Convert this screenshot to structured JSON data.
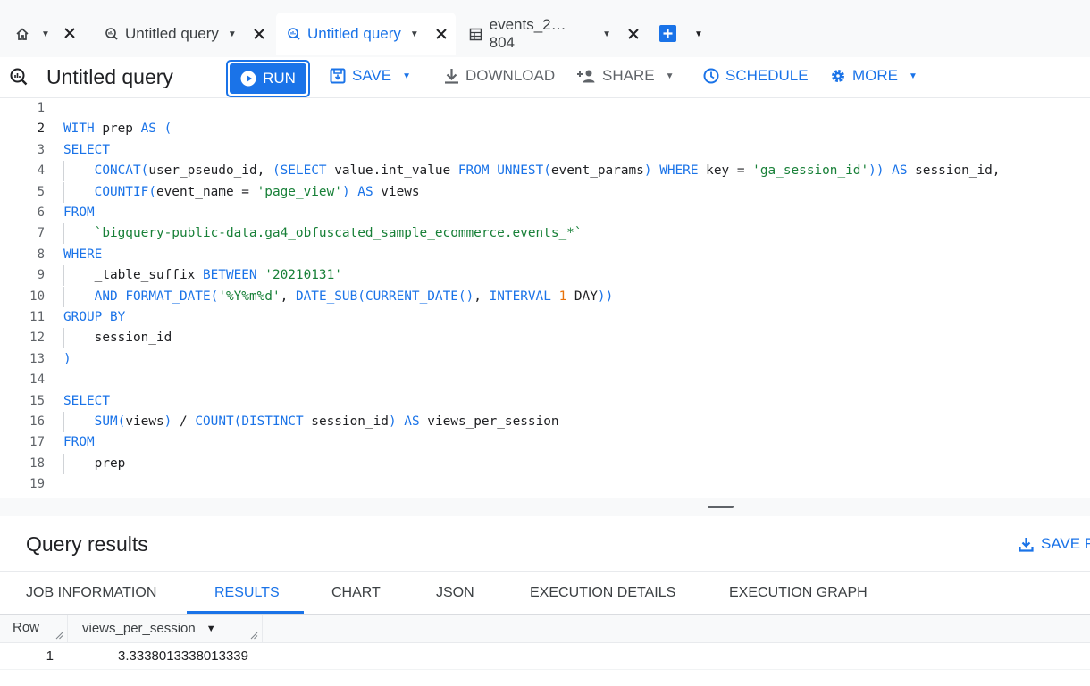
{
  "tabs": [
    {
      "label": "Untitled query",
      "active": false
    },
    {
      "label": "Untitled query",
      "active": true
    },
    {
      "label": "events_2… 804",
      "active": false
    }
  ],
  "toolbar": {
    "title": "Untitled query",
    "run_label": "RUN",
    "save_label": "SAVE",
    "download_label": "DOWNLOAD",
    "share_label": "SHARE",
    "schedule_label": "SCHEDULE",
    "more_label": "MORE"
  },
  "editor": {
    "line_numbers": [
      "1",
      "2",
      "3",
      "4",
      "5",
      "6",
      "7",
      "8",
      "9",
      "10",
      "11",
      "12",
      "13",
      "14",
      "15",
      "16",
      "17",
      "18",
      "19"
    ],
    "current_line": 2,
    "lines": [
      "",
      "WITH prep AS (",
      "SELECT",
      "    CONCAT(user_pseudo_id, (SELECT value.int_value FROM UNNEST(event_params) WHERE key = 'ga_session_id')) AS session_id,",
      "    COUNTIF(event_name = 'page_view') AS views",
      "FROM",
      "    `bigquery-public-data.ga4_obfuscated_sample_ecommerce.events_*`",
      "WHERE",
      "    _table_suffix BETWEEN '20210131'",
      "    AND FORMAT_DATE('%Y%m%d', DATE_SUB(CURRENT_DATE(), INTERVAL 1 DAY))",
      "GROUP BY",
      "    session_id",
      ")",
      "",
      "SELECT",
      "    SUM(views) / COUNT(DISTINCT session_id) AS views_per_session",
      "FROM",
      "    prep",
      ""
    ]
  },
  "results": {
    "title": "Query results",
    "save_results_label": "SAVE R",
    "tabs": [
      "JOB INFORMATION",
      "RESULTS",
      "CHART",
      "JSON",
      "EXECUTION DETAILS",
      "EXECUTION GRAPH"
    ],
    "active_tab": "RESULTS",
    "columns": [
      "Row",
      "views_per_session"
    ],
    "rows": [
      [
        "1",
        "3.3338013338013339"
      ]
    ]
  },
  "colors": {
    "accent": "#1a73e8",
    "keyword": "#1a73e8",
    "string": "#188038",
    "number": "#e8710a"
  }
}
